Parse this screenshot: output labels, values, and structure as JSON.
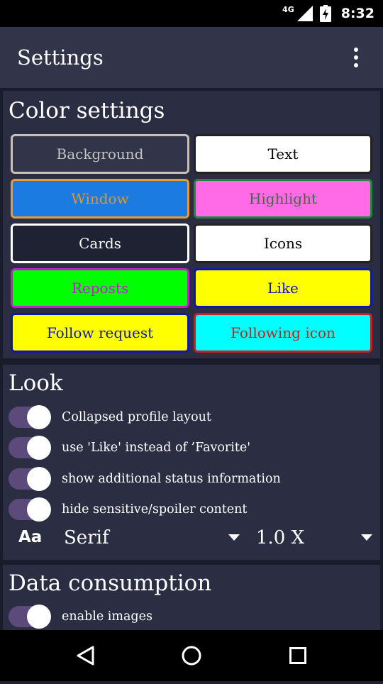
{
  "status_bar": {
    "network": "4G",
    "time": "8:32"
  },
  "app_bar": {
    "title": "Settings",
    "menu_icon": "more-vert-icon"
  },
  "color_settings": {
    "title": "Color settings",
    "buttons": [
      {
        "label": "Background",
        "bg": "#323449",
        "border": "#c8c2b4",
        "text": "#c2c2c2"
      },
      {
        "label": "Text",
        "bg": "#ffffff",
        "border": "#222222",
        "text": "#000000"
      },
      {
        "label": "Window",
        "bg": "#1b7be0",
        "border": "#e69a3a",
        "text": "#e0962e"
      },
      {
        "label": "Highlight",
        "bg": "#ff6ae6",
        "border": "#1c8a3a",
        "text": "#3f6a44"
      },
      {
        "label": "Cards",
        "bg": "#1f2232",
        "border": "#ffffff",
        "text": "#ffffff"
      },
      {
        "label": "Icons",
        "bg": "#ffffff",
        "border": "#222222",
        "text": "#000000"
      },
      {
        "label": "Reposts",
        "bg": "#00ff00",
        "border": "#c021c9",
        "text": "#c021c9"
      },
      {
        "label": "Like",
        "bg": "#ffff00",
        "border": "#1316a8",
        "text": "#1316a8"
      },
      {
        "label": "Follow request",
        "bg": "#ffff00",
        "border": "#1316a8",
        "text": "#1316a8"
      },
      {
        "label": "Following icon",
        "bg": "#00ffff",
        "border": "#c42222",
        "text": "#c42222"
      }
    ]
  },
  "look": {
    "title": "Look",
    "toggles": [
      {
        "label": "Collapsed profile layout",
        "on": true
      },
      {
        "label": "use 'Like' instead of ’Favorite'",
        "on": true
      },
      {
        "label": "show additional status information",
        "on": true
      },
      {
        "label": "hide sensitive/spoiler content",
        "on": true
      }
    ],
    "font_icon": "Aa",
    "font_select": "Serif",
    "scale_select": "1.0 X"
  },
  "data_consumption": {
    "title": "Data consumption",
    "toggles": [
      {
        "label": "enable images",
        "on": true
      }
    ]
  },
  "nav_bar": {
    "back": "back-icon",
    "home": "home-icon",
    "recents": "recents-icon"
  },
  "colors": {
    "app_bar": "#323449",
    "card": "#2b2d42",
    "switch_track": "#5c4a7a"
  }
}
